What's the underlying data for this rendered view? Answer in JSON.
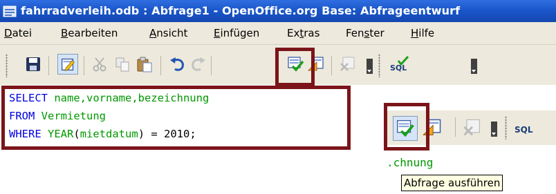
{
  "window": {
    "title": "fahrradverleih.odb : Abfrage1 - OpenOffice.org Base: Abfrageentwurf"
  },
  "menubar": {
    "items": [
      {
        "pre": "",
        "acc": "D",
        "post": "atei"
      },
      {
        "pre": "",
        "acc": "B",
        "post": "earbeiten"
      },
      {
        "pre": "",
        "acc": "A",
        "post": "nsicht"
      },
      {
        "pre": "",
        "acc": "E",
        "post": "infügen"
      },
      {
        "pre": "Ex",
        "acc": "t",
        "post": "ras"
      },
      {
        "pre": "Fen",
        "acc": "s",
        "post": "ter"
      },
      {
        "pre": "",
        "acc": "H",
        "post": "ilfe"
      }
    ]
  },
  "toolbar": {
    "icons": [
      "save-icon",
      "edit-mode-icon",
      "cut-icon",
      "copy-icon",
      "paste-icon",
      "undo-icon",
      "redo-icon",
      "run-query-icon",
      "design-view-icon",
      "clear-query-icon",
      "sql-icon"
    ]
  },
  "sql": {
    "line1": {
      "kw": "SELECT",
      "rest": " name,vorname,bezeichnung"
    },
    "line2": {
      "kw": "FROM",
      "rest": " Vermietung"
    },
    "line3": {
      "kw": "WHERE",
      "func": " YEAR",
      "paren_open": "(",
      "arg": "mietdatum",
      "rest": ") = 2010;"
    }
  },
  "zoom": {
    "partial_text": ".chnung",
    "tooltip": "Abfrage ausführen"
  },
  "colors": {
    "highlight": "#7b1419",
    "keyword": "#0000e0",
    "identifier": "#009900",
    "titlebar": "#1955c9",
    "chrome": "#ede9dc"
  }
}
